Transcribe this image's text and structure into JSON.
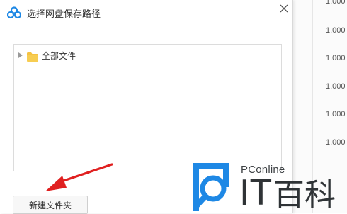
{
  "dialog": {
    "title": "选择网盘保存路径",
    "tree": {
      "root_label": "全部文件"
    },
    "new_folder_label": "新建文件夹"
  },
  "background": {
    "values": [
      "1.000",
      "1.000",
      "1.000",
      "1.000",
      "1.000",
      "1.000"
    ]
  },
  "watermark": {
    "brand": "PConline",
    "it": "IT",
    "name_rest": "百科"
  },
  "colors": {
    "accent_blue": "#1e88e5",
    "folder_yellow": "#f5c242",
    "annotation_red": "#e02020"
  },
  "icons": {
    "app": "baidu-cloud-icon",
    "close": "close-icon",
    "expand": "chevron-right-icon",
    "folder": "folder-icon",
    "watermark_logo": "search-magnifier-icon"
  }
}
